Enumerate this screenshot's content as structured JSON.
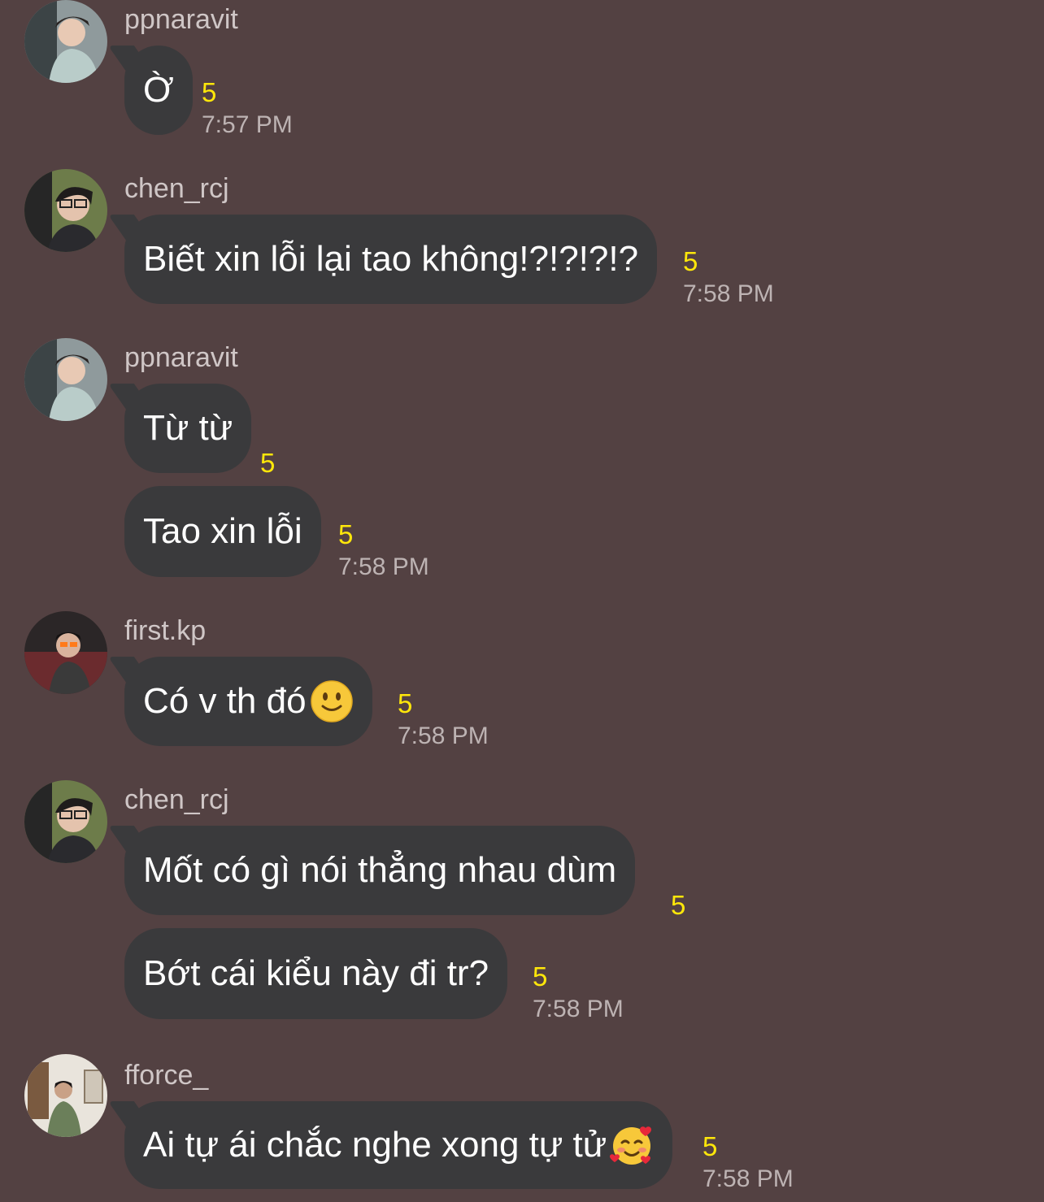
{
  "theme": {
    "background": "#534142",
    "bubble": "#3a3a3c",
    "count_color": "#ffe70a"
  },
  "messages": [
    {
      "sender": "ppnaravit",
      "avatar": "avatar-ppnaravit",
      "lines": [
        {
          "text": "Ờ",
          "count": "5"
        }
      ],
      "time": "7:57 PM"
    },
    {
      "sender": "chen_rcj",
      "avatar": "avatar-chen",
      "lines": [
        {
          "text": "Biết xin lỗi lại tao không!?!?!?!?",
          "count": "5"
        }
      ],
      "time": "7:58 PM"
    },
    {
      "sender": "ppnaravit",
      "avatar": "avatar-ppnaravit",
      "lines": [
        {
          "text": "Từ từ",
          "count": "5"
        },
        {
          "text": "Tao xin lỗi",
          "count": "5"
        }
      ],
      "time": "7:58 PM"
    },
    {
      "sender": "first.kp",
      "avatar": "avatar-first",
      "lines": [
        {
          "text": "Có v th đó",
          "emoji": "slightly-smiling-face-icon",
          "count": "5"
        }
      ],
      "time": "7:58 PM"
    },
    {
      "sender": "chen_rcj",
      "avatar": "avatar-chen",
      "lines": [
        {
          "text": "Mốt có gì nói thẳng nhau dùm",
          "count": "5"
        },
        {
          "text": "Bớt cái kiểu này đi tr?",
          "count": "5"
        }
      ],
      "time": "7:58 PM"
    },
    {
      "sender": "fforce_",
      "avatar": "avatar-fforce",
      "lines": [
        {
          "text": "Ai tự ái chắc nghe xong tự tử",
          "emoji": "smiling-face-with-hearts-icon",
          "count": "5"
        }
      ],
      "time": "7:58 PM"
    }
  ]
}
